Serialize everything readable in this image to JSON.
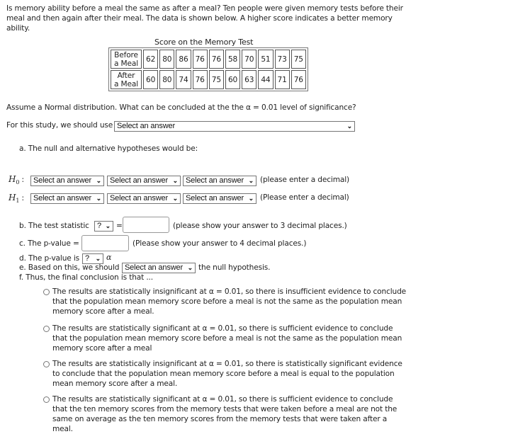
{
  "question": {
    "intro": "Is memory ability before a meal the same as after a meal?  Ten people were given memory tests before their meal and then again after their meal. The data is shown below. A higher score indicates a better memory ability.",
    "table_caption": "Score on the Memory Test",
    "table": {
      "rows": [
        {
          "label_line1": "Before",
          "label_line2": "a Meal",
          "values": [
            "62",
            "80",
            "86",
            "76",
            "76",
            "58",
            "70",
            "51",
            "73",
            "75"
          ]
        },
        {
          "label_line1": "After",
          "label_line2": "a Meal",
          "values": [
            "60",
            "80",
            "74",
            "76",
            "75",
            "60",
            "63",
            "44",
            "71",
            "76"
          ]
        }
      ]
    },
    "assume_text": "Assume a Normal distribution.  What can be concluded at the the α = 0.01 level of significance?",
    "study_label": "For this study, we should use",
    "study_select": "Select an answer"
  },
  "part_a": {
    "label": "a. The null and alternative hypotheses would be:",
    "h0_symbol": "H",
    "h0_sub": "0",
    "h1_symbol": "H",
    "h1_sub": "1",
    "colon": ":",
    "h0_selects": [
      "Select an answer",
      "Select an answer",
      "Select an answer"
    ],
    "h1_selects": [
      "Select an answer",
      "Select an answer",
      "Select an answer"
    ],
    "h0_hint": "(please enter a decimal)",
    "h1_hint": "(Please enter a decimal)"
  },
  "part_b": {
    "label": "b. The test statistic",
    "select": "?",
    "equals": "=",
    "value": "",
    "hint": "(please show your answer to 3 decimal places.)"
  },
  "part_c": {
    "label": "c. The p-value =",
    "value": "",
    "hint": "(Please show your answer to 4 decimal places.)"
  },
  "part_d": {
    "label": "d. The p-value is",
    "select": "?",
    "alpha": "α"
  },
  "part_e": {
    "label": "e. Based on this, we should",
    "select": "Select an answer",
    "suffix": "the null hypothesis."
  },
  "part_f": {
    "label": "f. Thus, the final conclusion is that ...",
    "options": [
      "The results are statistically insignificant at α = 0.01, so there is insufficient evidence to conclude that the population mean memory score before a meal is not the same as the population mean memory score after a meal.",
      "The results are statistically significant at α = 0.01, so there is sufficient evidence to conclude that the population mean memory score before a meal is not the same as the population mean memory score after a meal",
      "The results are statistically insignificant at α = 0.01, so there is statistically significant evidence to conclude that the population mean memory score before a meal is equal to the population mean memory score after a meal.",
      "The results are statistically significant at α = 0.01, so there is sufficient evidence to conclude that the ten memory scores from the memory tests that were taken before a meal are not the same on average as the ten memory scores from the memory tests that were taken after a meal."
    ]
  },
  "icons": {
    "chevron": "⌵"
  }
}
